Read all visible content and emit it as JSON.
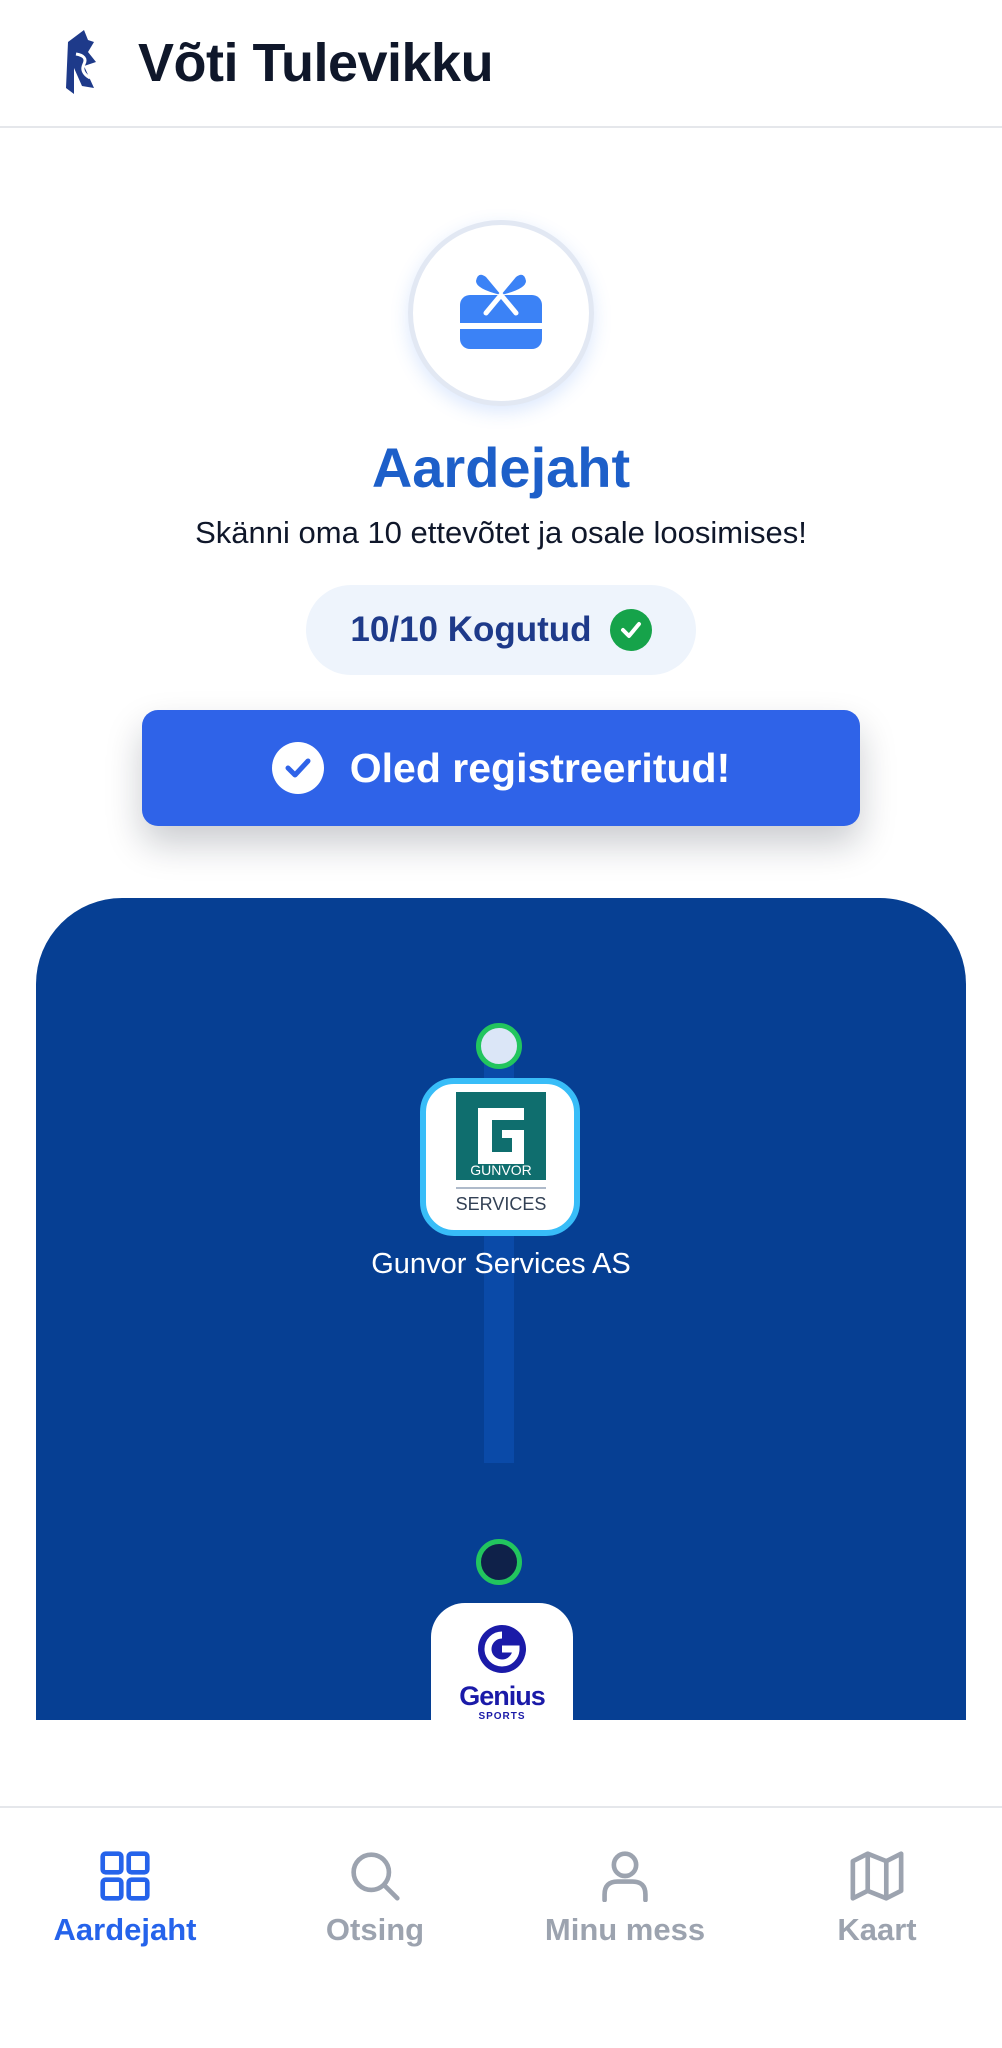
{
  "header": {
    "title": "Võti Tulevikku",
    "logo_icon": "voti-logo-icon"
  },
  "hero": {
    "icon": "gift-card-icon",
    "title": "Aardejaht",
    "subtitle": "Skänni oma 10 ettevõtet ja osale loosimises!",
    "progress_label": "10/10 Kogutud",
    "progress": {
      "collected": 10,
      "total": 10
    }
  },
  "register_button": {
    "label": "Oled registreeritud!",
    "icon": "check-circle-icon"
  },
  "trail": {
    "companies": [
      {
        "name": "Gunvor Services AS",
        "logo_top": "GUNVOR",
        "logo_bottom": "SERVICES",
        "scanned": true
      },
      {
        "name": "",
        "logo_word": "Genius",
        "logo_sub": "SPORTS",
        "scanned": false
      }
    ]
  },
  "bottom_nav": {
    "items": [
      {
        "label": "Aardejaht",
        "icon": "grid-icon",
        "active": true
      },
      {
        "label": "Otsing",
        "icon": "search-icon",
        "active": false
      },
      {
        "label": "Minu mess",
        "icon": "user-icon",
        "active": false
      },
      {
        "label": "Kaart",
        "icon": "map-icon",
        "active": false
      }
    ]
  },
  "colors": {
    "brand_blue": "#2f63e8",
    "title_blue": "#1d5fc9",
    "panel_navy": "#063f93",
    "success_green": "#16a34a",
    "nav_inactive": "#9ca3af",
    "nav_active": "#2563eb"
  }
}
